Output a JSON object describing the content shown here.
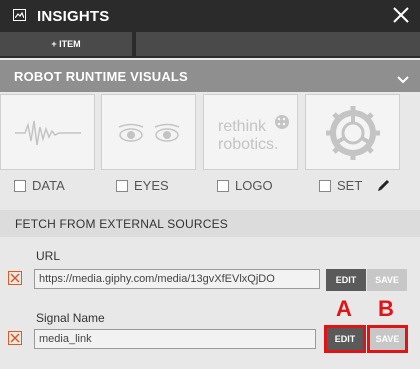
{
  "window": {
    "title": "INSIGHTS"
  },
  "tabs": {
    "add_label": "+ ITEM"
  },
  "section": {
    "title": "ROBOT RUNTIME VISUALS"
  },
  "visuals": [
    {
      "label": "DATA",
      "icon": "signal-wave-icon"
    },
    {
      "label": "EYES",
      "icon": "eyes-icon"
    },
    {
      "label": "LOGO",
      "icon": "rethink-logo"
    },
    {
      "label": "SET",
      "icon": "gear-icon"
    }
  ],
  "logo": {
    "line1": "rethink",
    "line2": "robotics."
  },
  "fetch": {
    "title": "FETCH FROM EXTERNAL SOURCES",
    "url": {
      "label": "URL",
      "value": "https://media.giphy.com/media/13gvXfEVlxQjDO"
    },
    "signal": {
      "label": "Signal Name",
      "value": "media_link"
    },
    "edit_label": "EDIT",
    "save_label": "SAVE"
  },
  "annotations": {
    "a": "A",
    "b": "B"
  },
  "colors": {
    "accent_orange": "#e05a1e",
    "annotation_red": "#e01414"
  }
}
